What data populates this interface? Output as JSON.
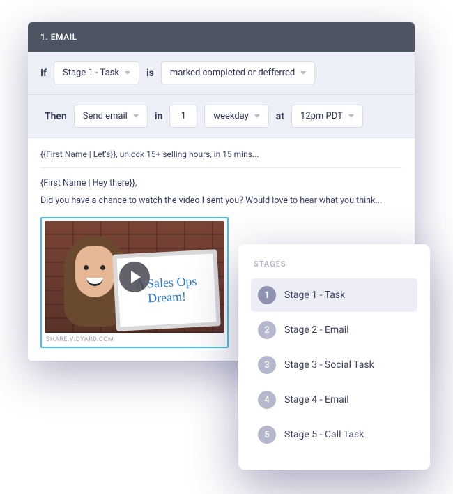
{
  "header": {
    "title": "1. EMAIL"
  },
  "rule": {
    "if_label": "If",
    "condition_field": "Stage 1 - Task",
    "is_label": "is",
    "condition_state": "marked completed or defferred",
    "then_label": "Then",
    "action": "Send email",
    "in_label": "in",
    "delay_value": "1",
    "delay_unit": "weekday",
    "at_label": "at",
    "time": "12pm PDT"
  },
  "email": {
    "subject": "{{First Name | Let's}}, unlock 15+ selling hours, in 15 mins...",
    "greeting": "{First Name | Hey there}},",
    "body": "Did you have a chance to watch the video I sent you? Would love to hear what you think...",
    "whiteboard_text": "A Sales Ops Dream!",
    "video_caption": "SHARE.VIDYARD.COM"
  },
  "stages": {
    "title": "STAGES",
    "items": [
      {
        "num": "1",
        "label": "Stage 1 - Task",
        "active": true
      },
      {
        "num": "2",
        "label": "Stage 2 - Email",
        "active": false
      },
      {
        "num": "3",
        "label": "Stage 3 - Social Task",
        "active": false
      },
      {
        "num": "4",
        "label": "Stage 4 - Email",
        "active": false
      },
      {
        "num": "5",
        "label": "Stage 5 - Call Task",
        "active": false
      }
    ]
  }
}
